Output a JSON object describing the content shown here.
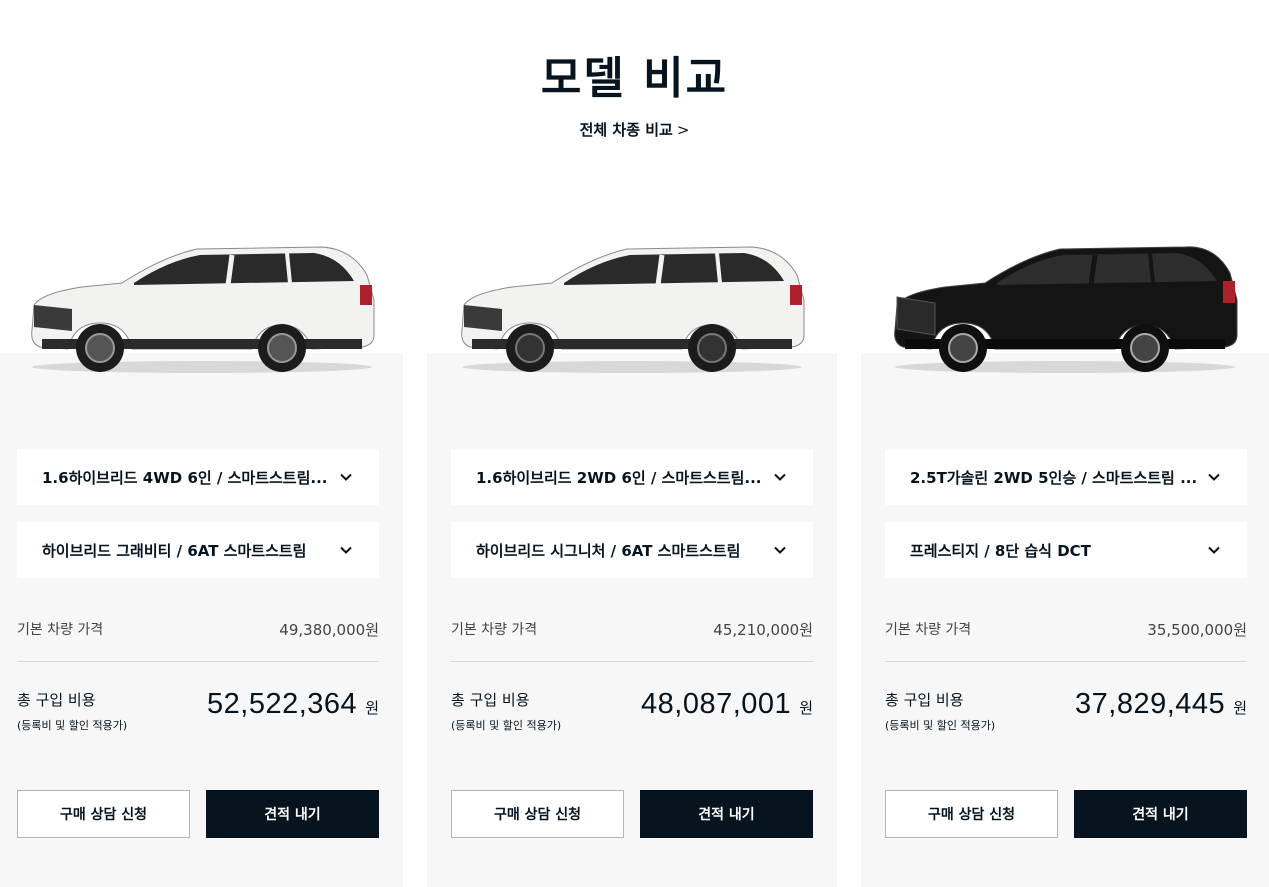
{
  "page": {
    "title": "모델 비교",
    "compare_all_label": "전체 차종 비교",
    "compare_all_arrow": ">"
  },
  "colors": {
    "primary": "#05141f",
    "card_background": "#f7f7f7",
    "car_1": "#f2f2f0",
    "car_2": "#f2f2f0",
    "car_3": "#141414"
  },
  "cards": [
    {
      "car_image": "white-suv-image",
      "trim_select": "1.6하이브리드 4WD 6인 / 스마트스트림...",
      "grade_select": "하이브리드 그래비티 / 6AT 스마트스트림",
      "base_label": "기본 차량 가격",
      "base_price": "49,380,000",
      "base_unit": "원",
      "total_label": "총 구입 비용",
      "total_note": "(등록비 및 할인 적용가)",
      "total_price": "52,522,364",
      "total_unit": "원",
      "consult_label": "구매 상담 신청",
      "quote_label": "견적 내기"
    },
    {
      "car_image": "white-suv-image",
      "trim_select": "1.6하이브리드 2WD 6인 / 스마트스트림...",
      "grade_select": "하이브리드 시그니처 / 6AT 스마트스트림",
      "base_label": "기본 차량 가격",
      "base_price": "45,210,000",
      "base_unit": "원",
      "total_label": "총 구입 비용",
      "total_note": "(등록비 및 할인 적용가)",
      "total_price": "48,087,001",
      "total_unit": "원",
      "consult_label": "구매 상담 신청",
      "quote_label": "견적 내기"
    },
    {
      "car_image": "black-suv-image",
      "trim_select": "2.5T가솔린 2WD 5인승 / 스마트스트림 ...",
      "grade_select": "프레스티지 / 8단 습식 DCT",
      "base_label": "기본 차량 가격",
      "base_price": "35,500,000",
      "base_unit": "원",
      "total_label": "총 구입 비용",
      "total_note": "(등록비 및 할인 적용가)",
      "total_price": "37,829,445",
      "total_unit": "원",
      "consult_label": "구매 상담 신청",
      "quote_label": "견적 내기"
    }
  ]
}
